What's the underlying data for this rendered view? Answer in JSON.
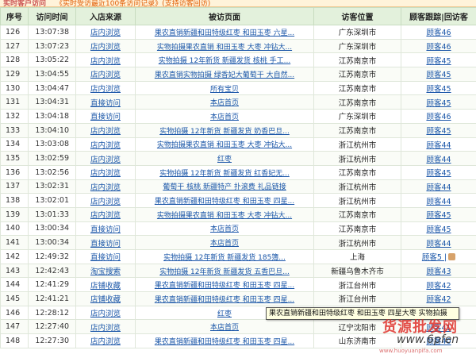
{
  "header_strip": {
    "title": "实时客户访问",
    "notice": "《实时受访最近100条访问记录》(支持访客回访)"
  },
  "columns": [
    "序号",
    "访问时间",
    "入店来源",
    "被访页面",
    "访客位置",
    "顾客跟踪|回访客"
  ],
  "rows": [
    {
      "no": "126",
      "time": "13:07:38",
      "source": "店内浏览",
      "page": "果农直销新疆和田特级红枣 和田玉枣 六星...",
      "loc": "广东深圳市",
      "track": "顾客46"
    },
    {
      "no": "127",
      "time": "13:07:23",
      "source": "店内浏览",
      "page": "实物拍摄果农直销 和田玉枣 大枣 冲钻大...",
      "loc": "广东深圳市",
      "track": "顾客46"
    },
    {
      "no": "128",
      "time": "13:05:22",
      "source": "店内浏览",
      "page": "实物拍摄 12年新货 新疆发货 核桃 手工...",
      "loc": "江苏南京市",
      "track": "顾客45"
    },
    {
      "no": "129",
      "time": "13:04:55",
      "source": "店内浏览",
      "page": "果农直销实物拍摄 绿香妃大葡萄干 大自然...",
      "loc": "江苏南京市",
      "track": "顾客45"
    },
    {
      "no": "130",
      "time": "13:04:47",
      "source": "店内浏览",
      "page": "所有宝贝",
      "loc": "江苏南京市",
      "track": "顾客45"
    },
    {
      "no": "131",
      "time": "13:04:31",
      "source": "直接访问",
      "page": "本店首页",
      "loc": "江苏南京市",
      "track": "顾客45"
    },
    {
      "no": "132",
      "time": "13:04:18",
      "source": "直接访问",
      "page": "本店首页",
      "loc": "广东深圳市",
      "track": "顾客46"
    },
    {
      "no": "133",
      "time": "13:04:10",
      "source": "店内浏览",
      "page": "实物拍摄 12年新货 新疆发货 奶香巴旦...",
      "loc": "江苏南京市",
      "track": "顾客45"
    },
    {
      "no": "134",
      "time": "13:03:08",
      "source": "店内浏览",
      "page": "实物拍摄果农直销 和田玉枣 大枣 冲钻大...",
      "loc": "浙江杭州市",
      "track": "顾客44"
    },
    {
      "no": "135",
      "time": "13:02:59",
      "source": "店内浏览",
      "page": "红枣",
      "loc": "浙江杭州市",
      "track": "顾客44"
    },
    {
      "no": "136",
      "time": "13:02:56",
      "source": "店内浏览",
      "page": "实物拍摄 12年新货 新疆发货 红香妃无...",
      "loc": "江苏南京市",
      "track": "顾客45"
    },
    {
      "no": "137",
      "time": "13:02:31",
      "source": "店内浏览",
      "page": "葡萄干 核桃 新疆特产 扑滚费 礼品链接",
      "loc": "浙江杭州市",
      "track": "顾客44"
    },
    {
      "no": "138",
      "time": "13:02:01",
      "source": "店内浏览",
      "page": "果农直销新疆和田特级红枣 和田玉枣 四星...",
      "loc": "浙江杭州市",
      "track": "顾客44"
    },
    {
      "no": "139",
      "time": "13:01:33",
      "source": "店内浏览",
      "page": "实物拍摄果农直销 和田玉枣 大枣 冲钻大...",
      "loc": "江苏南京市",
      "track": "顾客45"
    },
    {
      "no": "140",
      "time": "13:00:34",
      "source": "直接访问",
      "page": "本店首页",
      "loc": "江苏南京市",
      "track": "顾客45"
    },
    {
      "no": "141",
      "time": "13:00:34",
      "source": "直接访问",
      "page": "本店首页",
      "loc": "浙江杭州市",
      "track": "顾客44"
    },
    {
      "no": "142",
      "time": "12:49:32",
      "source": "直接访问",
      "page": "实物拍摄 12年新货 新疆发货 185簿...",
      "loc": "上海",
      "track": "顾客5 |"
    },
    {
      "no": "143",
      "time": "12:42:43",
      "source": "淘宝搜索",
      "page": "实物拍摄 12年新货 新疆发货 五香巴旦...",
      "loc": "新疆乌鲁木齐市",
      "track": "顾客43"
    },
    {
      "no": "144",
      "time": "12:41:29",
      "source": "店铺收藏",
      "page": "果农直销新疆和田特级红枣 和田玉枣 四星...",
      "loc": "浙江台州市",
      "track": "顾客42"
    },
    {
      "no": "145",
      "time": "12:41:21",
      "source": "店铺收藏",
      "page": "果农直销新疆和田特级红枣 和田玉枣 四星...",
      "loc": "浙江台州市",
      "track": "顾客42"
    },
    {
      "no": "146",
      "time": "12:28:12",
      "source": "店内浏览",
      "page": "红枣",
      "loc": "辽宁沈阳市",
      "track": "顾客41"
    },
    {
      "no": "147",
      "time": "12:27:40",
      "source": "店内浏览",
      "page": "本店首页",
      "loc": "辽宁沈阳市",
      "track": "顾客41"
    },
    {
      "no": "148",
      "time": "12:27:30",
      "source": "店内浏览",
      "page": "果农直销新疆和田特级红枣 和田玉枣 四星...",
      "loc": "山东济南市",
      "track": "顾客40"
    }
  ],
  "tooltip": "果农直销新疆和田特级红枣 和田玉枣 四星大枣 实物拍摄",
  "watermark": {
    "logo_text": "货源批发网",
    "domain": "www.6pfen",
    "small": "www.huoyuanpifa.com"
  }
}
